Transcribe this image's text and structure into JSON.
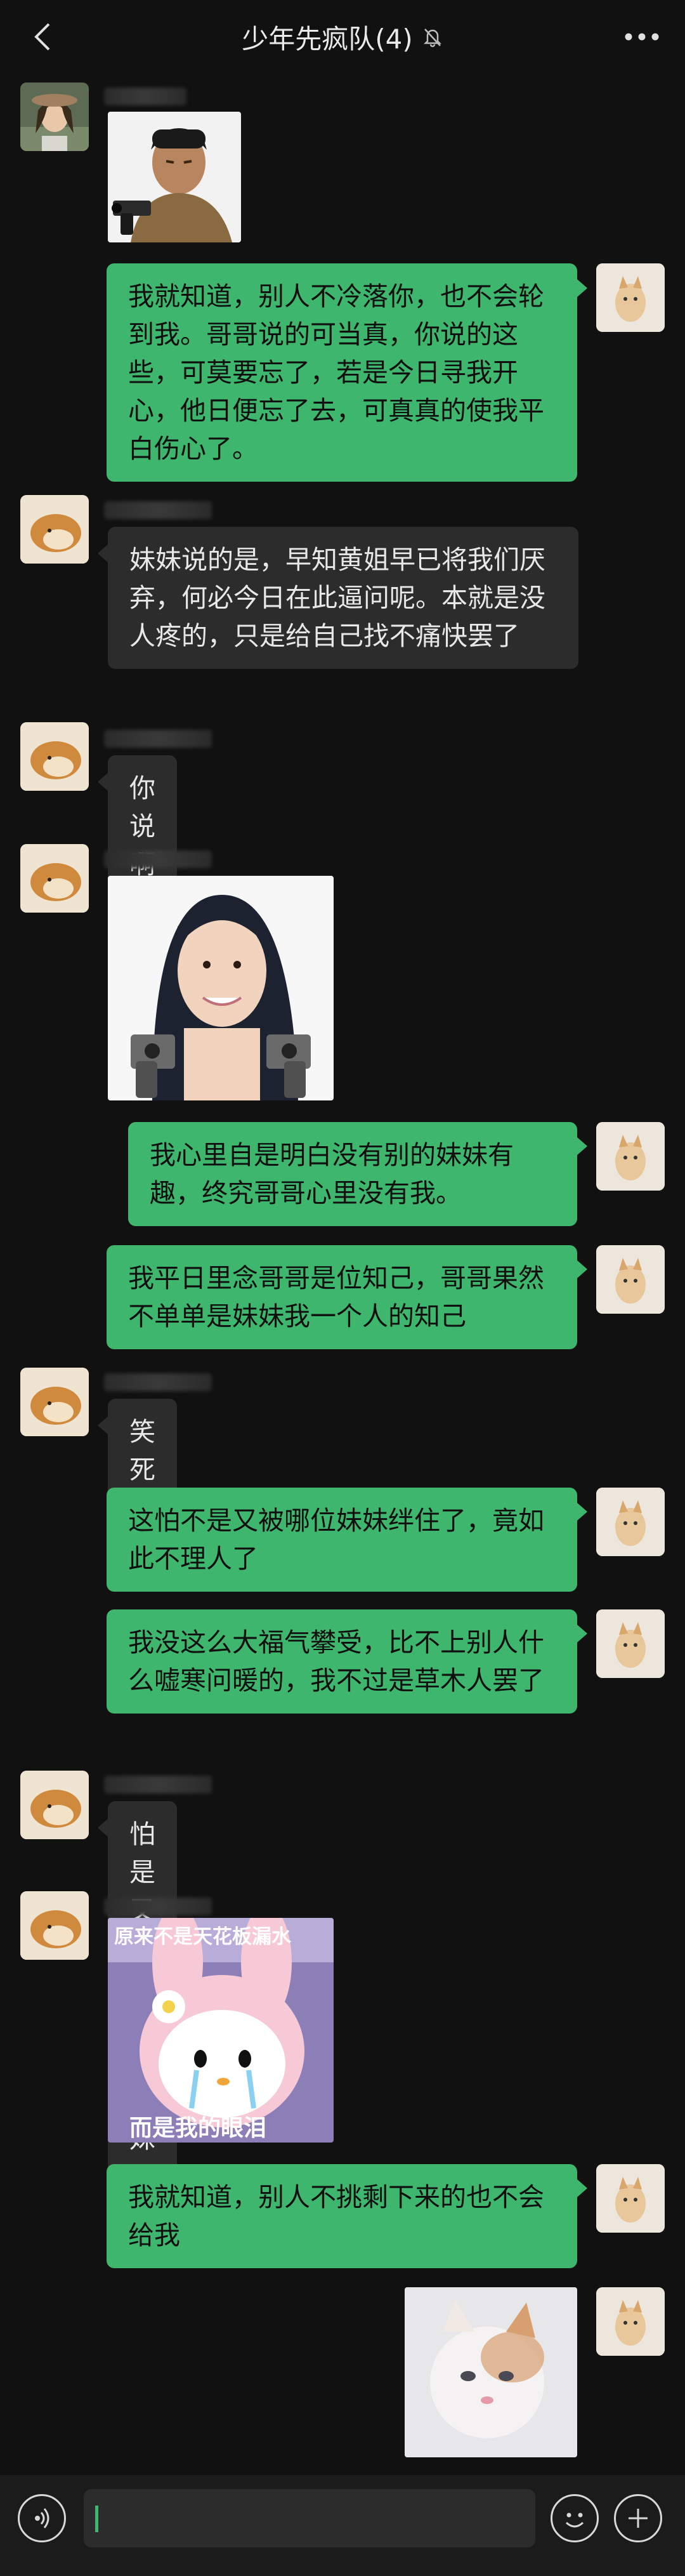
{
  "header": {
    "title": "少年先疯队(4)",
    "back_icon": "chevron-left-icon",
    "mute_icon": "bell-off-icon",
    "more_icon": "more-dots-icon"
  },
  "messages": [
    {
      "side": "in",
      "type": "image",
      "image": "man-with-gun-sticker",
      "avatar": "girl-avatar"
    },
    {
      "side": "out",
      "type": "text",
      "text": "我就知道，别人不冷落你，也不会轮到我。哥哥说的可当真，你说的这些，可莫要忘了，若是今日寻我开心，他日便忘了去，可真真的使我平白伤心了。"
    },
    {
      "side": "in",
      "type": "text",
      "text": "妹妹说的是，早知黄姐早已将我们厌弃，何必今日在此逼问呢。本就是没人疼的，只是给自己找不痛快罢了"
    },
    {
      "side": "in",
      "type": "text",
      "text": "你说啊"
    },
    {
      "side": "in",
      "type": "image",
      "image": "woman-with-two-guns-sticker"
    },
    {
      "side": "out",
      "type": "text",
      "text": "我心里自是明白没有别的妹妹有趣，终究哥哥心里没有我。"
    },
    {
      "side": "out",
      "type": "text",
      "text": "我平日里念哥哥是位知己，哥哥果然不单单是妹妹我一个人的知己"
    },
    {
      "side": "in",
      "type": "text",
      "text": "笑死我了"
    },
    {
      "side": "out",
      "type": "text",
      "text": "这怕不是又被哪位妹妹绊住了，竟如此不理人了"
    },
    {
      "side": "out",
      "type": "text",
      "text": "我没这么大福气攀受，比不上别人什么嘘寒问暖的，我不过是草木人罢了"
    },
    {
      "side": "in",
      "type": "text",
      "text": "怕是又在哄哪位妹妹了"
    },
    {
      "side": "in",
      "type": "image",
      "image": "crying-bunny-sticker",
      "caption_top": "原来不是天花板漏水",
      "caption_bottom": "而是我的眼泪"
    },
    {
      "side": "out",
      "type": "text",
      "text": "我就知道，别人不挑剩下来的也不会给我"
    },
    {
      "side": "out",
      "type": "image",
      "image": "crying-cat-sticker"
    }
  ],
  "footer": {
    "voice_icon": "voice-icon",
    "emoji_icon": "emoji-icon",
    "plus_icon": "plus-icon",
    "input_value": ""
  },
  "colors": {
    "background": "#111111",
    "incoming_bubble": "#2c2c2c",
    "outgoing_bubble": "#3fb66d"
  }
}
